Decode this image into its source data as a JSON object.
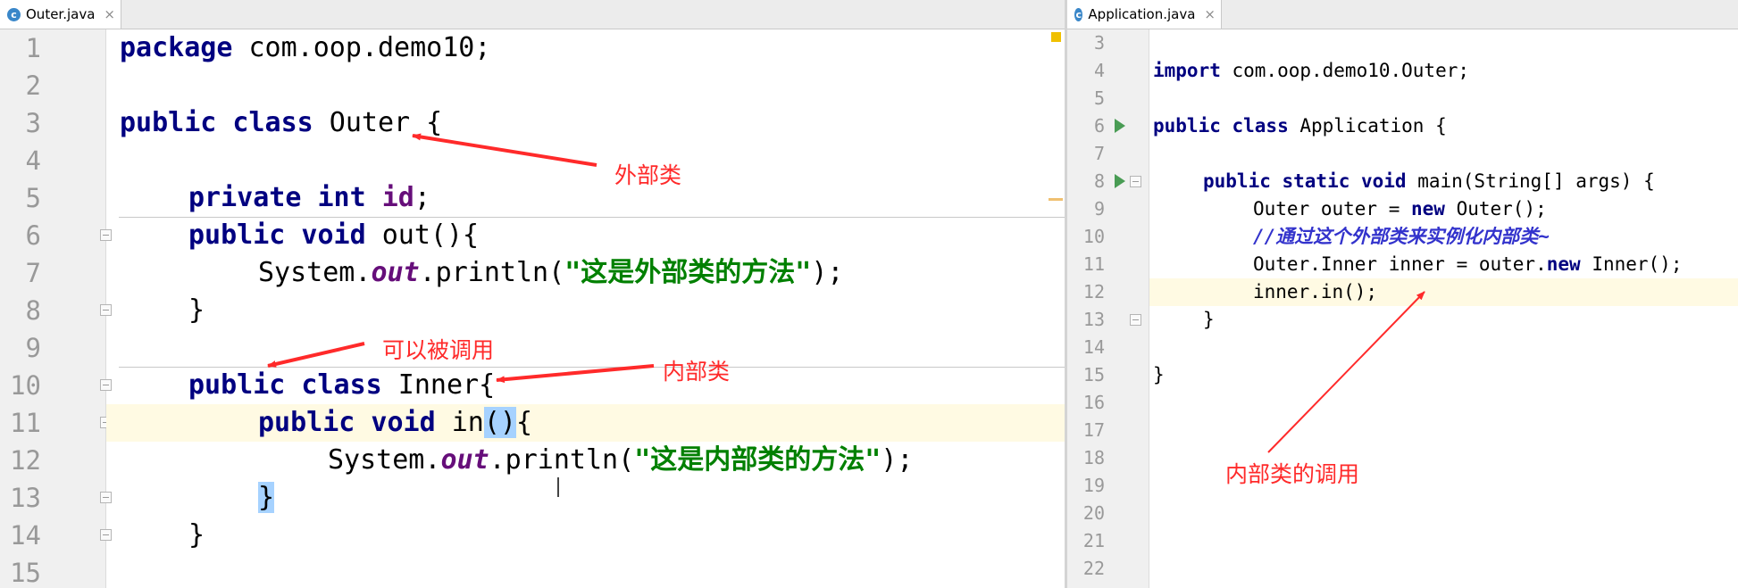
{
  "left_editor": {
    "tab_label": "Outer.java",
    "tab_icon_letter": "c",
    "close_symbol": "×",
    "line_numbers": [
      "1",
      "2",
      "3",
      "4",
      "5",
      "6",
      "7",
      "8",
      "9",
      "10",
      "11",
      "12",
      "13",
      "14",
      "15"
    ],
    "code": {
      "l1_kw": "package",
      "l1_rest": " com.oop.demo10;",
      "l3_kw": "public class",
      "l3_rest": " Outer {",
      "l5_kw": "private int",
      "l5_field": "id",
      "l5_end": ";",
      "l6_kw": "public void",
      "l6_rest": " out(){",
      "l7_a": "System.",
      "l7_field": "out",
      "l7_b": ".println(",
      "l7_str": "\"这是外部类的方法\"",
      "l7_end": ");",
      "l8": "}",
      "l10_kw": "public class",
      "l10_rest": " Inner{",
      "l11_kw": "public void",
      "l11_a": " in",
      "l11_sel": "()",
      "l11_end": "{",
      "l12_a": "System.",
      "l12_field": "out",
      "l12_b": ".println(",
      "l12_str": "\"这是内部类的方法\"",
      "l12_end": ");",
      "l13": "}",
      "l14": "}"
    }
  },
  "right_editor": {
    "tab_label": "Application.java",
    "tab_icon_letter": "c",
    "close_symbol": "×",
    "line_numbers": [
      "3",
      "4",
      "5",
      "6",
      "7",
      "8",
      "9",
      "10",
      "11",
      "12",
      "13",
      "14",
      "15",
      "16",
      "17",
      "18",
      "19",
      "20",
      "21",
      "22"
    ],
    "code": {
      "l4_kw": "import",
      "l4_rest": " com.oop.demo10.Outer;",
      "l6_kw": "public class",
      "l6_rest": " Application {",
      "l8_kw": "public static void",
      "l8_rest": " main(String[] args) {",
      "l9_a": "Outer outer = ",
      "l9_kw": "new",
      "l9_b": " Outer();",
      "l10_comment": "//通过这个外部类来实例化内部类~",
      "l11_a": "Outer.Inner inner = outer.",
      "l11_kw": "new",
      "l11_b": " Inner();",
      "l12": "inner.in();",
      "l13": "}",
      "l15": "}"
    }
  },
  "annotations": {
    "outer_class": "外部类",
    "can_be_called": "可以被调用",
    "inner_class": "内部类",
    "inner_call": "内部类的调用"
  },
  "colors": {
    "keyword": "#000080",
    "string": "#008000",
    "field": "#660e7a",
    "comment": "#3333cc",
    "annotation": "#ff2a2a",
    "current_line": "#fffae3",
    "selection": "#a6d2ff"
  }
}
